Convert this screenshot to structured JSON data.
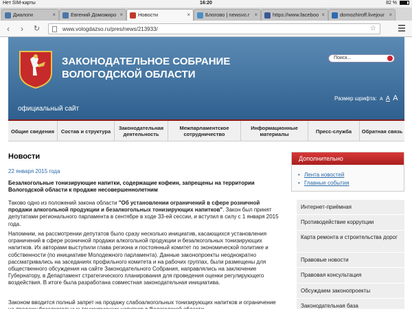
{
  "status_bar": {
    "carrier": "Нет SIM-карты",
    "time": "16:20",
    "battery": "82 %",
    "battery_level": 0.82
  },
  "browser": {
    "tabs": [
      {
        "label": "Диалоги",
        "icon": "vk-icon",
        "color": "#4a76a8"
      },
      {
        "label": "Евгений Доможиро",
        "icon": "vk-icon",
        "color": "#4a76a8"
      },
      {
        "label": "Новости",
        "icon": "site-icon",
        "color": "#c0392b"
      },
      {
        "label": "Блогово | newsvo.r",
        "icon": "blog-icon",
        "color": "#4a90c8"
      },
      {
        "label": "https://www.faceboo",
        "icon": "facebook-icon",
        "color": "#3b5998"
      },
      {
        "label": "domozhiroff.livejour",
        "icon": "livejournal-icon",
        "color": "#2d6bb0"
      }
    ],
    "address": "www.vologdazso.ru/pres/news/213933/"
  },
  "site": {
    "title": "ЗАКОНОДАТЕЛЬНОЕ СОБРАНИЕ ВОЛОГОДСКОЙ ОБЛАСТИ",
    "subtitle": "официальный сайт",
    "search_placeholder": "Поиск...",
    "font_size_label": "Размер шрифта:",
    "font_size_options": [
      "А",
      "А",
      "А"
    ]
  },
  "nav": [
    "Общие сведения",
    "Состав и структура",
    "Законодательная деятельность",
    "Межпарламентское сотрудничество",
    "Информационные материалы",
    "Пресс-служба",
    "Обратная связь"
  ],
  "article": {
    "section_title": "Новости",
    "date": "22 января 2015 года",
    "headline": "Безалкогольные тонизирующие напитки, содержащие кофеин, запрещены на территории Вологодской области к продаже несовершеннолетним",
    "p1_before": "Таково одно из положений закона области ",
    "p1_bold": "\"Об установлении ограничений в сфере розничной продажи алкогольной продукции и безалкогольных тонизирующих напитков\"",
    "p1_after": ". Закон был принят депутатами регионального парламента в сентябре в ходе 33-ей сессии, и вступил в силу с 1 января 2015 года.",
    "p2": "Напомним, на рассмотрении депутатов было сразу несколько инициатив, касающихся установления ограничений в сфере розничной продажи алкогольной продукции и безалкогольных тонизирующих напитков. Их авторами выступили глава региона и постоянный комитет по экономической политике и собственности (по инициативе Молодежного парламента). Данные законопроекты неоднократно рассматривались на заседаниях профильного комитета и на рабочих группах, были размещены для общественного обсуждения на сайте Законодательного Собрания, направлялись на заключение Губернатору, в Департамент стратегического планирования для проведения оценки регулирующего воздействия. В итоге была разработана совместная законодательная инициатива.",
    "p3": "Законом вводится полный запрет на продажу слабоалкогольных тонизирующих напитков и ограничение на продажу безалкогольных тонизирующих напитков в Вологодской области"
  },
  "aside": {
    "title": "Дополнительно",
    "links": [
      "Лента новостей",
      "Главные события"
    ],
    "menu": [
      "Интернет-приёмная",
      "Противодействие коррупции",
      "Карта ремонта и строительства дорог",
      "Правовые новости",
      "Правовая консультация",
      "Обсуждаем законопроекты",
      "Законодательная база"
    ]
  }
}
